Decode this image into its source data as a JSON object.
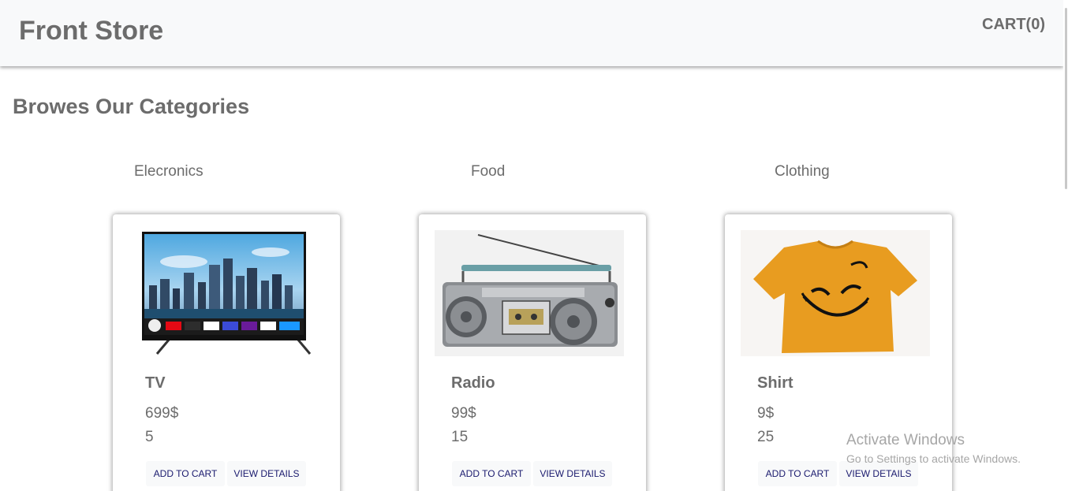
{
  "header": {
    "brand": "Front Store",
    "cart_label": "CART(0)"
  },
  "section_title": "Browes Our Categories",
  "categories": [
    "Elecronics",
    "Food",
    "Clothing"
  ],
  "products": [
    {
      "name": "TV",
      "price": "699$",
      "quantity": "5",
      "add_label": "ADD TO CART",
      "view_label": "VIEW DETAILS",
      "image": "tv-image"
    },
    {
      "name": "Radio",
      "price": "99$",
      "quantity": "15",
      "add_label": "ADD TO CART",
      "view_label": "VIEW DETAILS",
      "image": "radio-image"
    },
    {
      "name": "Shirt",
      "price": "9$",
      "quantity": "25",
      "add_label": "ADD TO CART",
      "view_label": "VIEW DETAILS",
      "image": "shirt-image"
    }
  ],
  "watermark": {
    "title": "Activate Windows",
    "subtitle": "Go to Settings to activate Windows."
  },
  "colors": {
    "header_bg": "#f8f9fa",
    "text": "#6c6c6c",
    "button_text": "#1a1a6e",
    "shirt": "#e89c20"
  }
}
